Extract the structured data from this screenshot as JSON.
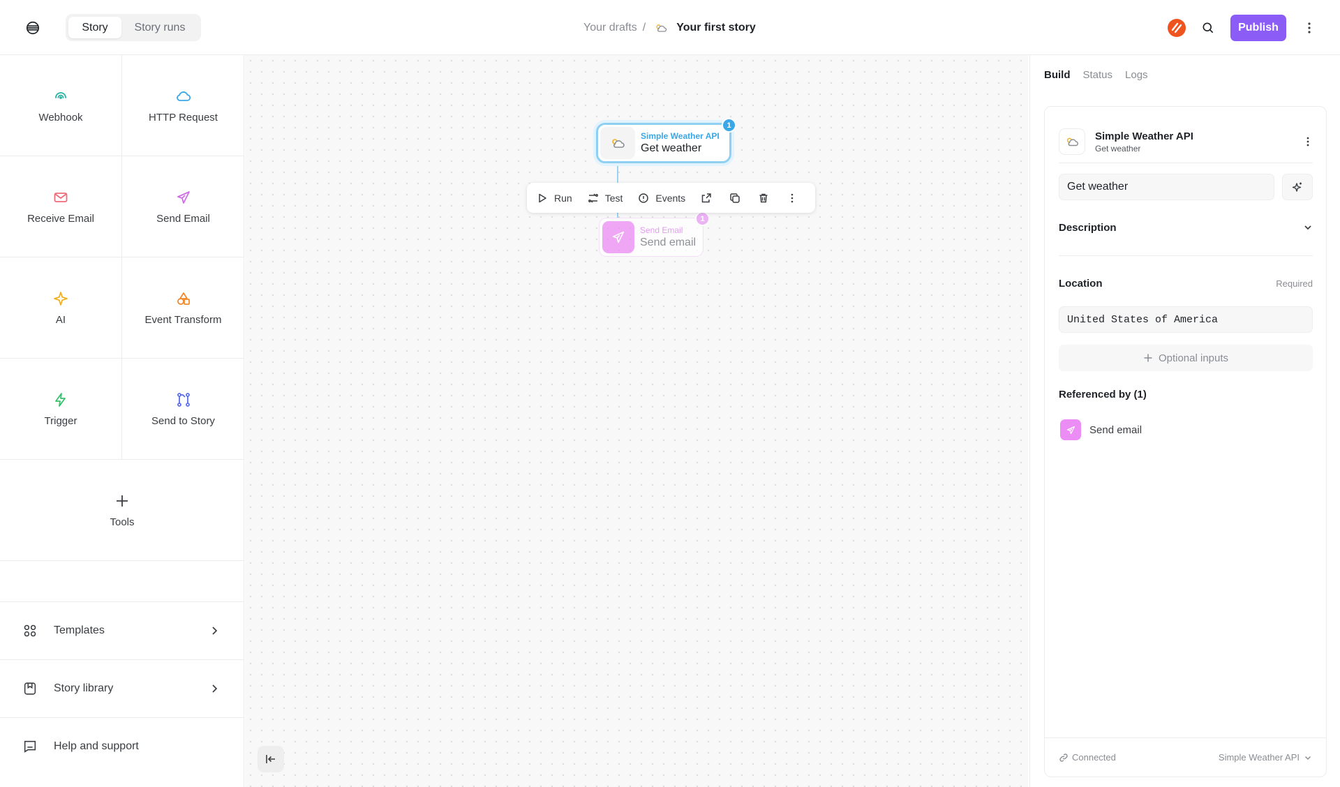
{
  "header": {
    "tabs": [
      {
        "label": "Story",
        "active": true
      },
      {
        "label": "Story runs",
        "active": false
      }
    ],
    "breadcrumb": {
      "parent": "Your drafts",
      "separator": "/",
      "current": "Your first story"
    },
    "publish_label": "Publish"
  },
  "sidebar": {
    "tiles": [
      {
        "label": "Webhook",
        "icon": "webhook-icon",
        "color": "#2bb3a3"
      },
      {
        "label": "HTTP Request",
        "icon": "cloud-icon",
        "color": "#3aa7e6"
      },
      {
        "label": "Receive Email",
        "icon": "mail-icon",
        "color": "#ef6b7b"
      },
      {
        "label": "Send Email",
        "icon": "send-icon",
        "color": "#d06ce8"
      },
      {
        "label": "AI",
        "icon": "sparkle-icon",
        "color": "#f2b01e"
      },
      {
        "label": "Event Transform",
        "icon": "shapes-icon",
        "color": "#f08a2c"
      },
      {
        "label": "Trigger",
        "icon": "bolt-icon",
        "color": "#35c26a"
      },
      {
        "label": "Send to Story",
        "icon": "branch-icon",
        "color": "#5b6ee8"
      },
      {
        "label": "Tools",
        "icon": "plus-icon",
        "color": "#3a3d42"
      }
    ],
    "nav": [
      {
        "label": "Templates",
        "icon": "grid-icon"
      },
      {
        "label": "Story library",
        "icon": "bookmark-icon"
      },
      {
        "label": "Help and support",
        "icon": "chat-icon"
      }
    ]
  },
  "canvas": {
    "main_node": {
      "kicker": "Simple Weather API",
      "title": "Get weather",
      "badge": "1",
      "kicker_color": "#3aa7e6"
    },
    "second_node": {
      "kicker": "Send Email",
      "title": "Send email",
      "badge": "1",
      "kicker_color": "#e07cf0"
    },
    "toolbar": {
      "run": "Run",
      "test": "Test",
      "events": "Events"
    }
  },
  "panel": {
    "tabs": [
      {
        "label": "Build",
        "active": true
      },
      {
        "label": "Status",
        "active": false
      },
      {
        "label": "Logs",
        "active": false
      }
    ],
    "card": {
      "title": "Simple Weather API",
      "subtitle": "Get weather",
      "name_value": "Get weather",
      "description_label": "Description",
      "location_label": "Location",
      "required_label": "Required",
      "location_value": "United States of America",
      "optional_label": "Optional inputs",
      "referenced_title": "Referenced by (1)",
      "referenced_item": "Send email",
      "connected_label": "Connected",
      "credential_label": "Simple Weather API"
    }
  },
  "colors": {
    "accent": "#8b5cf6",
    "node_border": "#8fcff2",
    "badge_blue": "#3aa7e6",
    "badge_pink": "#e79cf3"
  }
}
